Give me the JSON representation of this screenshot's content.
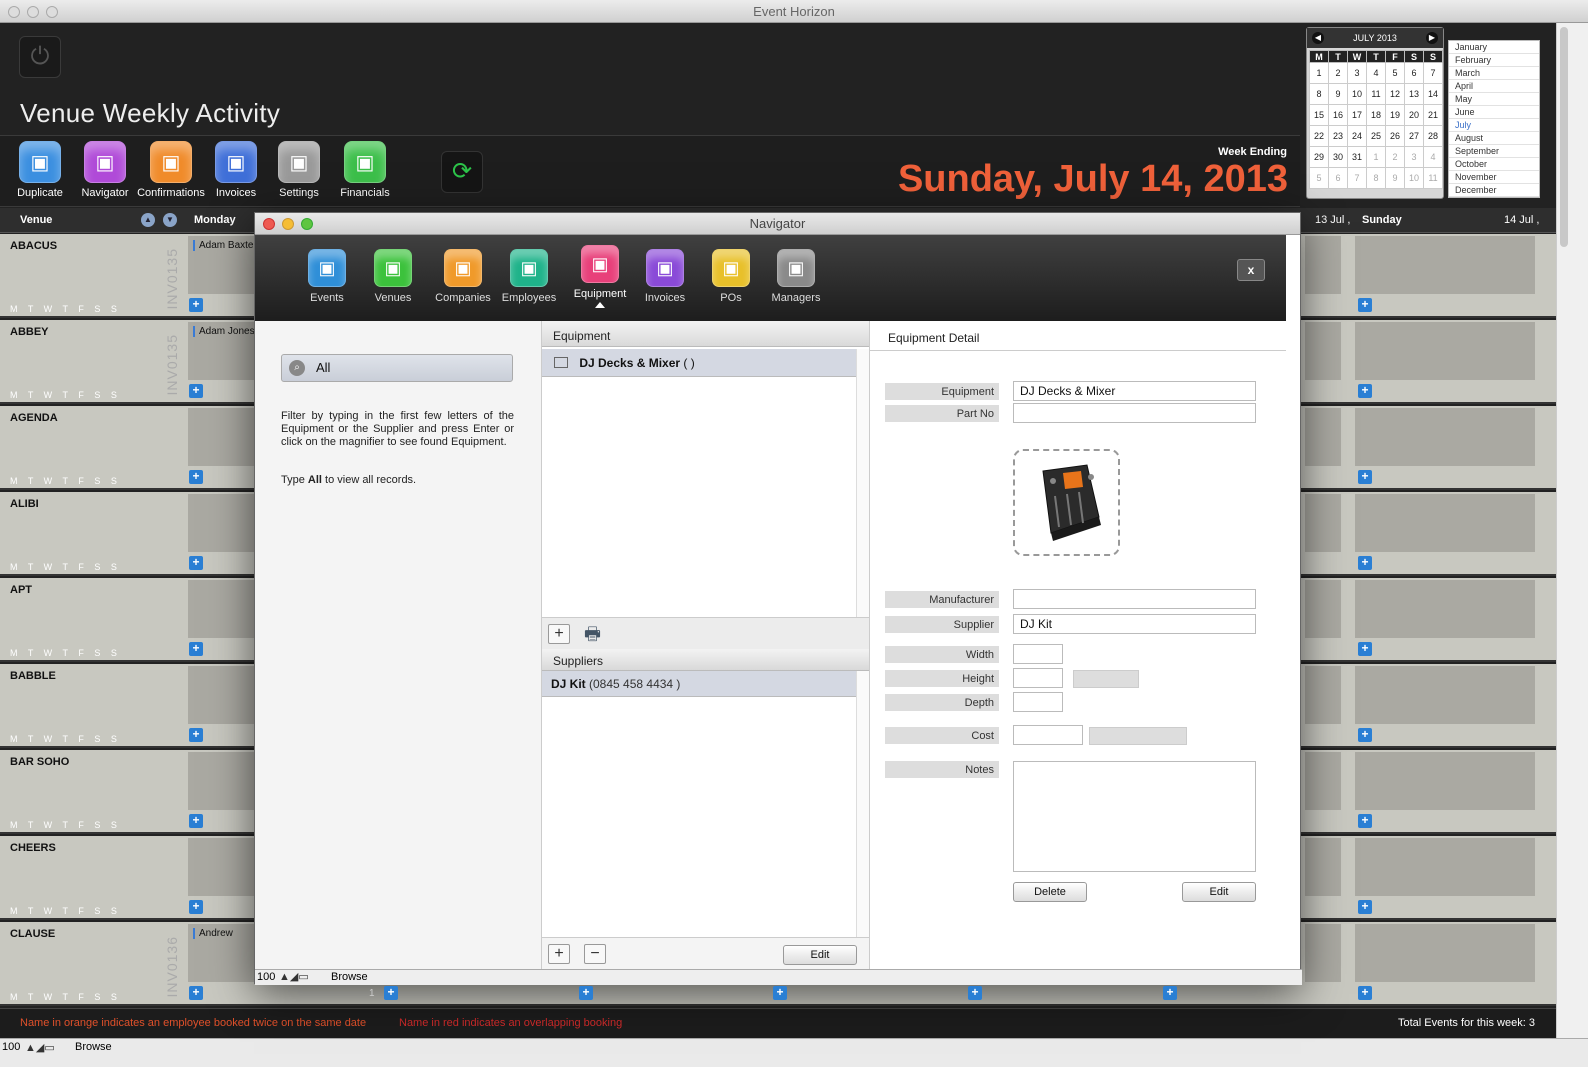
{
  "window": {
    "title": "Event Horizon"
  },
  "page": {
    "title": "Venue Weekly Activity"
  },
  "toolbar": {
    "buttons": [
      {
        "label": "Duplicate",
        "icon": "duplicate-icon",
        "color": "#3b8fe0"
      },
      {
        "label": "Navigator",
        "icon": "navigator-icon",
        "color": "#b04ad8"
      },
      {
        "label": "Confirmations",
        "icon": "printer-icon",
        "color": "#f08b2a"
      },
      {
        "label": "Invoices",
        "icon": "invoices-icon",
        "color": "#3f6fd8"
      },
      {
        "label": "Settings",
        "icon": "gear-icon",
        "color": "#9a9a9a"
      },
      {
        "label": "Financials",
        "icon": "financials-icon",
        "color": "#3cbf4a"
      }
    ],
    "refresh_icon": "refresh-icon"
  },
  "week": {
    "label": "Week Ending",
    "date": "Sunday, July 14, 2013",
    "color": "#f0613a"
  },
  "calendar": {
    "month_label": "JULY 2013",
    "weekdays": [
      "M",
      "T",
      "W",
      "T",
      "F",
      "S",
      "S"
    ],
    "weeks": [
      [
        "1",
        "2",
        "3",
        "4",
        "5",
        "6",
        "7"
      ],
      [
        "8",
        "9",
        "10",
        "11",
        "12",
        "13",
        "14"
      ],
      [
        "15",
        "16",
        "17",
        "18",
        "19",
        "20",
        "21"
      ],
      [
        "22",
        "23",
        "24",
        "25",
        "26",
        "27",
        "28"
      ],
      [
        "29",
        "30",
        "31",
        "1",
        "2",
        "3",
        "4"
      ],
      [
        "5",
        "6",
        "7",
        "8",
        "9",
        "10",
        "11"
      ]
    ],
    "months": [
      "January",
      "February",
      "March",
      "April",
      "May",
      "June",
      "July",
      "August",
      "September",
      "October",
      "November",
      "December"
    ],
    "selected_month": "July"
  },
  "columns": {
    "venue": "Venue",
    "monday": "Monday",
    "saturday_date": "13 Jul ,",
    "sunday": "Sunday",
    "sunday_date": "14 Jul ,"
  },
  "venues": [
    {
      "name": "ABACUS",
      "invoice": "INV0135",
      "booking": "Adam Baxte"
    },
    {
      "name": "ABBEY",
      "invoice": "INV0135",
      "booking": "Adam Jones"
    },
    {
      "name": "AGENDA",
      "invoice": "",
      "booking": ""
    },
    {
      "name": "ALIBI",
      "invoice": "",
      "booking": ""
    },
    {
      "name": "APT",
      "invoice": "",
      "booking": ""
    },
    {
      "name": "BABBLE",
      "invoice": "",
      "booking": ""
    },
    {
      "name": "BAR SOHO",
      "invoice": "",
      "booking": ""
    },
    {
      "name": "CHEERS",
      "invoice": "",
      "booking": ""
    },
    {
      "name": "CLAUSE",
      "invoice": "INV0136",
      "booking": "Andrew"
    }
  ],
  "day_letters": "M T W T F S S",
  "status": {
    "orange_note": "Name in orange indicates an employee booked twice on the same date",
    "red_note": "Name in red indicates an overlapping booking",
    "total": "Total Events for this week: 3",
    "row_marker": "1"
  },
  "bottom": {
    "zoom": "100",
    "mode": "Browse"
  },
  "navigator": {
    "title": "Navigator",
    "tabs": [
      {
        "label": "Events",
        "icon": "calendar-icon",
        "color": "#2f8fd8"
      },
      {
        "label": "Venues",
        "icon": "house-icon",
        "color": "#3cc23c"
      },
      {
        "label": "Companies",
        "icon": "companies-icon",
        "color": "#f09a2a"
      },
      {
        "label": "Employees",
        "icon": "headphones-icon",
        "color": "#1fb38a"
      },
      {
        "label": "Equipment",
        "icon": "equipment-icon",
        "color": "#e8407a"
      },
      {
        "label": "Invoices",
        "icon": "invoices-icon",
        "color": "#8a4ad8"
      },
      {
        "label": "POs",
        "icon": "po-icon",
        "color": "#e8c02a"
      },
      {
        "label": "Managers",
        "icon": "person-icon",
        "color": "#8a8a8a"
      }
    ],
    "active_tab": "Equipment",
    "close_label": "x",
    "search": {
      "value": "All"
    },
    "filter_help": "Filter by typing in the first few letters of the Equipment or the Supplier and press Enter or click on the magnifier to see found Equipment.",
    "type_all_prefix": "Type ",
    "type_all_bold": "All",
    "type_all_suffix": " to view all records.",
    "equipment_header": "Equipment",
    "equipment_items": [
      {
        "name": "DJ Decks & Mixer",
        "extra": "(  )"
      }
    ],
    "suppliers_header": "Suppliers",
    "suppliers": [
      {
        "name": "DJ Kit",
        "phone": "(0845 458 4434 )"
      }
    ],
    "list_edit": "Edit",
    "detail": {
      "header": "Equipment Detail",
      "labels": {
        "equipment": "Equipment",
        "part_no": "Part No",
        "manufacturer": "Manufacturer",
        "supplier": "Supplier",
        "width": "Width",
        "height": "Height",
        "depth": "Depth",
        "cost": "Cost",
        "notes": "Notes"
      },
      "values": {
        "equipment": "DJ Decks & Mixer",
        "part_no": "",
        "manufacturer": "",
        "supplier": "DJ Kit",
        "width": "",
        "height": "",
        "depth": "",
        "cost": "",
        "notes": ""
      },
      "delete": "Delete",
      "edit": "Edit"
    },
    "status": {
      "zoom": "100",
      "mode": "Browse"
    }
  }
}
